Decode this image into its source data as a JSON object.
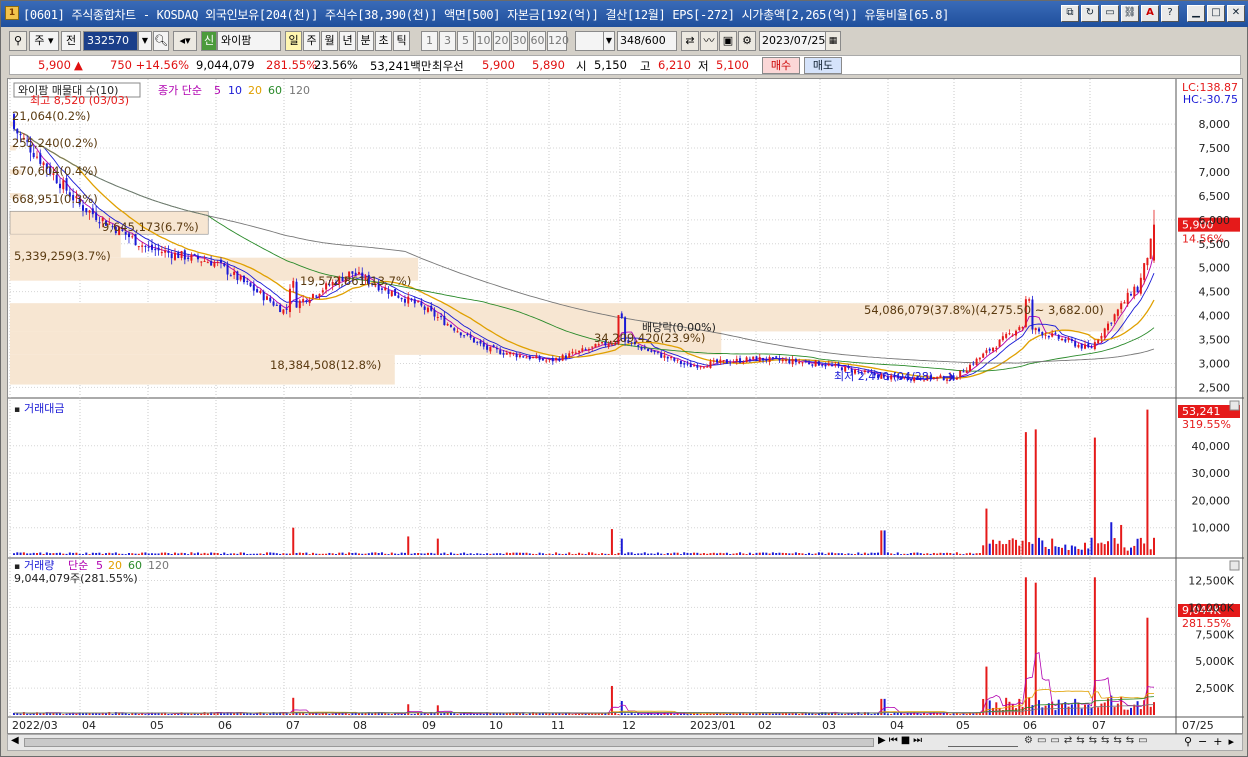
{
  "window": {
    "title": "[0601] 주식종합차트 - KOSDAQ 외국인보유[204(천)] 주식수[38,390(천)] 액면[500] 자본금[192(억)] 결산[12월] EPS[-272] 시가총액[2,265(억)] 유통비율[65.8]",
    "buttons": [
      "restore-layout-icon",
      "refresh-icon",
      "window-icon",
      "link-icon",
      "text-icon",
      "help-icon",
      "minimize-icon",
      "maximize-icon",
      "close-icon"
    ]
  },
  "toolbar": {
    "market": "주",
    "prev": "전",
    "code": "332570",
    "stock_tag": "신",
    "stock_name": "와이팜",
    "periods": [
      "일",
      "주",
      "월",
      "년",
      "분",
      "초",
      "틱"
    ],
    "intervals": [
      "1",
      "3",
      "5",
      "10",
      "20",
      "30",
      "60",
      "120"
    ],
    "count": "348",
    "count_total": "/600",
    "date": "2023/07/25"
  },
  "quote": {
    "price": "5,900",
    "change": "750 +14.56%",
    "volume": "9,044,079",
    "volume_ratio": "281.55%",
    "turnover": "23.56%",
    "amount": "53,241백만",
    "best_label": "최우선",
    "best_ask": "5,900",
    "best_bid": "5,890",
    "open_label": "시",
    "open": "5,150",
    "high_label": "고",
    "high": "6,210",
    "low_label": "저",
    "low": "5,100",
    "buy": "매수",
    "sell": "매도"
  },
  "colors": {
    "up": "#e51a1a",
    "down": "#1a1ad6",
    "ma5": "#b000b0",
    "ma10": "#1a1ad6",
    "ma20": "#e0a000",
    "ma60": "#2a8a2a",
    "ma120": "#777777",
    "band": "#f7e6d2"
  },
  "price_panel": {
    "legend": "와이팜 매물대 수(10)",
    "ma_legend": {
      "label": "종가 단순",
      "p5": "5",
      "p10": "10",
      "p20": "20",
      "p60": "60",
      "p120": "120"
    },
    "lc": "LC:138.87",
    "hc": "HC:-30.75",
    "high_note": "최고 8,520 (03/03)",
    "low_note": "최저 2,470 (04/28)",
    "dividend_note": "배당락(0.00%)",
    "last_price": "5,900",
    "last_pct": "14.56%",
    "y_ticks": [
      "8,000",
      "7,500",
      "7,000",
      "6,500",
      "6,000",
      "5,500",
      "5,000",
      "4,500",
      "4,000",
      "3,500",
      "3,000",
      "2,500"
    ],
    "bands": [
      "21,064(0.2%)",
      "255,240(0.2%)",
      "670,604(0.4%)",
      "668,951(0.3%)",
      "9,645,173(6.7%)",
      "5,339,259(3.7%)",
      "19,572,861(13.7%)",
      "54,086,079(37.8%)(4,275.50 ~ 3,682.00)",
      "34,209,420(23.9%)",
      "18,384,508(12.8%)"
    ]
  },
  "amount_panel": {
    "legend": "거래대금",
    "last": "53,241",
    "last_pct": "319.55%",
    "y_ticks": [
      "40,000",
      "30,000",
      "20,000",
      "10,000"
    ]
  },
  "volume_panel": {
    "legend": "거래량",
    "ma_legend": {
      "label": "단순",
      "p5": "5",
      "p20": "20",
      "p60": "60",
      "p120": "120"
    },
    "value_note": "9,044,079주(281.55%)",
    "last": "9,044K",
    "last_pct": "281.55%",
    "y_ticks": [
      "12,500K",
      "10,000K",
      "7,500K",
      "5,000K",
      "2,500K"
    ]
  },
  "x_axis": [
    "2022/03",
    "04",
    "05",
    "06",
    "07",
    "08",
    "09",
    "10",
    "11",
    "12",
    "2023/01",
    "02",
    "03",
    "04",
    "05",
    "06",
    "07",
    "07/25"
  ],
  "chart_data": {
    "type": "candlestick",
    "x": [
      "2022/03",
      "04",
      "05",
      "06",
      "07",
      "08",
      "09",
      "10",
      "11",
      "12",
      "2023/01",
      "02",
      "03",
      "04",
      "05",
      "06",
      "07",
      "07/25"
    ],
    "series": [
      {
        "name": "종가",
        "values": [
          8000,
          6300,
          5400,
          5100,
          4100,
          4900,
          4200,
          3300,
          3050,
          3500,
          2950,
          3100,
          3000,
          2700,
          2700,
          3800,
          3300,
          5900
        ]
      }
    ],
    "ylim": [
      2300,
      8600
    ]
  }
}
